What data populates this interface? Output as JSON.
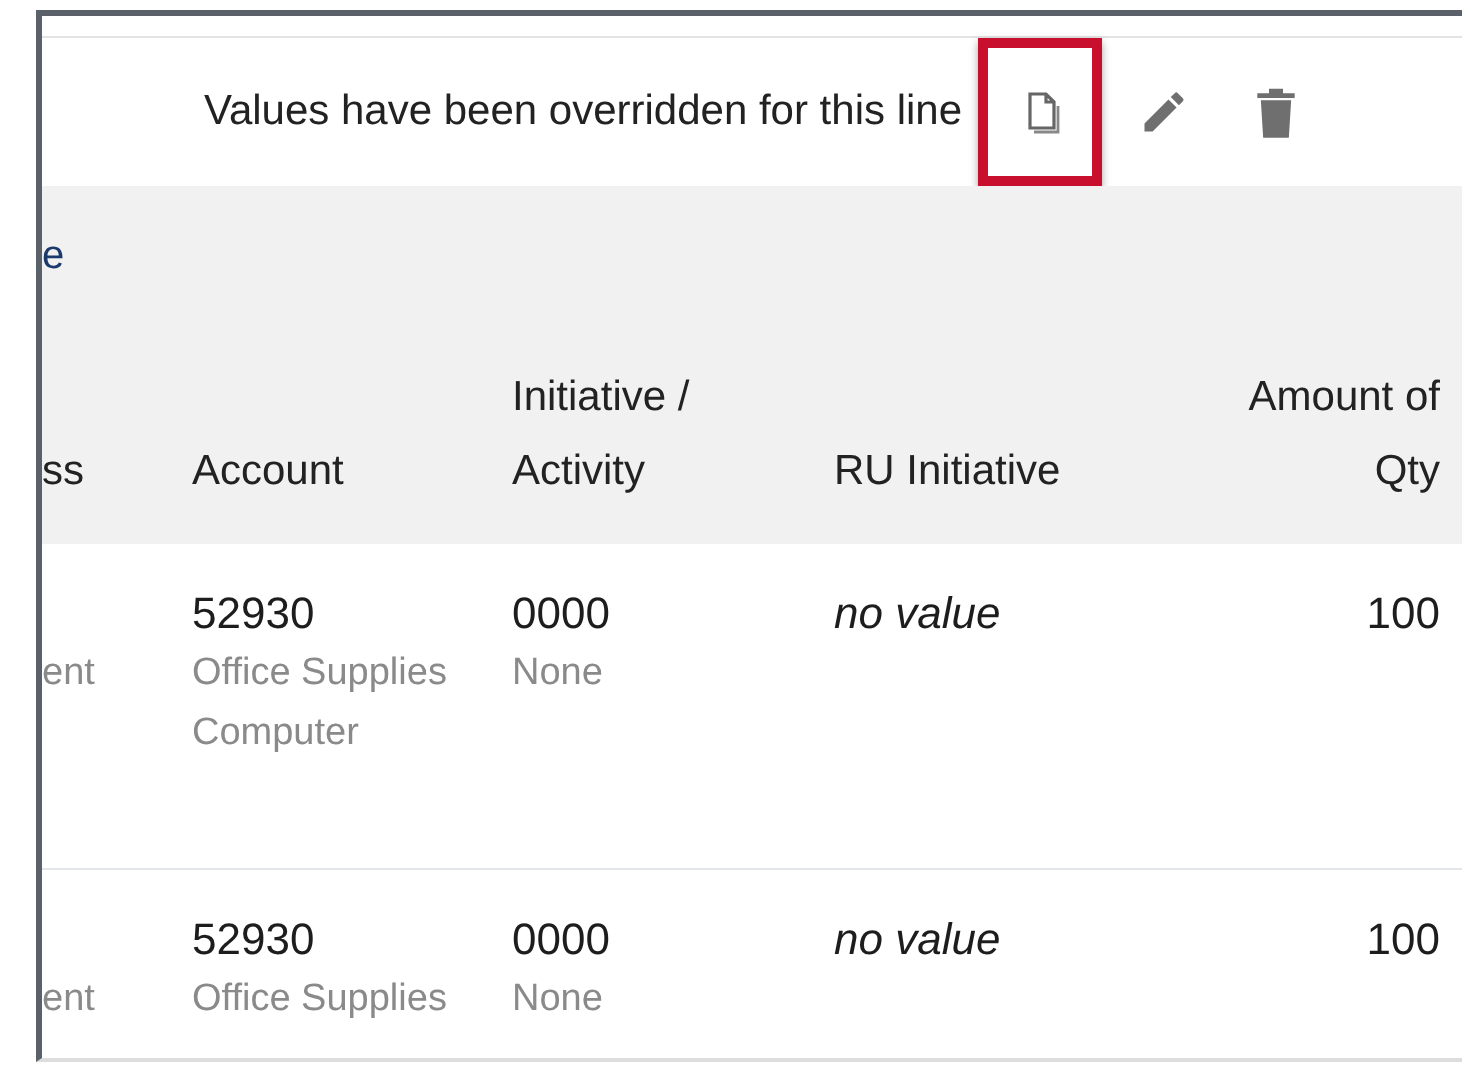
{
  "banner": {
    "message": "Values have been overridden for this line",
    "actions": [
      {
        "kind": "copy",
        "highlighted": true
      },
      {
        "kind": "edit",
        "highlighted": false
      },
      {
        "kind": "delete",
        "highlighted": false
      }
    ]
  },
  "section": {
    "title": "e"
  },
  "table": {
    "columns": [
      {
        "label": "ss"
      },
      {
        "label": "Account"
      },
      {
        "label": "Initiative / Activity"
      },
      {
        "label": "RU Initiative"
      },
      {
        "label": "Amount of Qty"
      }
    ],
    "rows": [
      {
        "column_1": "ent",
        "account": "52930",
        "account_detail": [
          "Office Supplies",
          "Computer"
        ],
        "initiative": "0000",
        "initiative_detail": "None",
        "ru_initiative": "no value",
        "amount": "100"
      },
      {
        "column_1": "ent",
        "account": "52930",
        "account_detail": [
          "Office Supplies"
        ],
        "initiative": "0000",
        "initiative_detail": "None",
        "ru_initiative": "no value",
        "amount": "100"
      }
    ]
  }
}
